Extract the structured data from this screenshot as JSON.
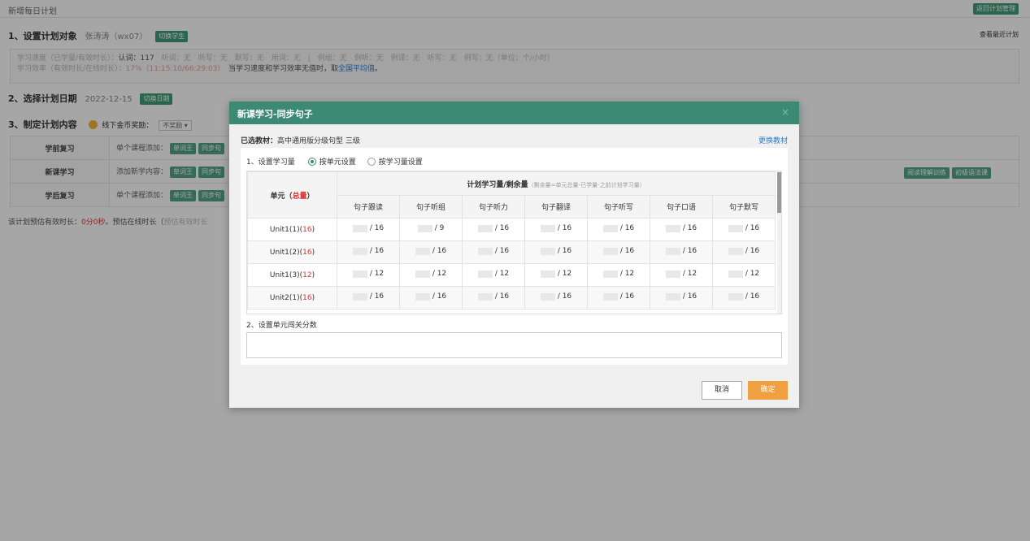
{
  "page": {
    "title": "新增每日计划",
    "back_button": "返回计划管理",
    "section1": {
      "label": "1、设置计划对象",
      "student": "张涛涛（wx07）",
      "switch_student": "切换学生",
      "view_recent": "查看最近计划"
    },
    "stats": {
      "speed_label": "学习速度（已学量/有效时长）：",
      "speed_highlight": "认词：117",
      "speed_rest": "听词：无　听写：无　默写：无　用词：无　|　例组：无　例听：无　例译：无　听写：无　例写：无（单位：个/小时）",
      "eff_label": "学习效率（有效时长/在线时长）：",
      "eff_value": "17%（11:15:10/66:29:03）",
      "eff_note": "当学习速度和学习效率无值时，取",
      "eff_link": "全国平均值",
      "eff_end": "。"
    },
    "section2": {
      "label": "2、选择计划日期",
      "date": "2022-12-15",
      "switch_date": "切换日期"
    },
    "section3": {
      "label": "3、制定计划内容",
      "coin_label": "线下金币奖励：",
      "coin_select": "不奖励 ▾"
    },
    "plan_rows": [
      {
        "head": "学前复习",
        "text": "单个课程添加：",
        "b1": "单词王",
        "b2": "同步句"
      },
      {
        "head": "新课学习",
        "text": "添加新学内容：",
        "b1": "单词王",
        "b2": "同步句",
        "r1": "阅读理解训练",
        "r2": "初级语法课"
      },
      {
        "head": "学后复习",
        "text": "单个课程添加：",
        "b1": "单词王",
        "b2": "同步句"
      }
    ],
    "estimate": {
      "label": "该计划预估有效时长：",
      "value": "0分0秒",
      "label2": "。预估在线时长（",
      "muted": "预估有效时长"
    }
  },
  "modal": {
    "title": "新课学习-同步句子",
    "close": "×",
    "material_label": "已选教材：",
    "material_value": "高中通用版分级句型 三级",
    "change_material": "更换教材",
    "step1": "1、设置学习量",
    "radio_unit": "按单元设置",
    "radio_amount": "按学习量设置",
    "table": {
      "unit_header": "单元（",
      "unit_header_red": "总量",
      "unit_header_end": "）",
      "group_header": "计划学习量/剩余量",
      "group_hint": "（剩余量=单元总量-已学量-之前计划学习量）",
      "columns": [
        "句子跟读",
        "句子听组",
        "句子听力",
        "句子翻译",
        "句子听写",
        "句子口语",
        "句子默写"
      ],
      "rows": [
        {
          "unit": "Unit1(1)(",
          "total": "16",
          "end": ")",
          "values": [
            "/ 16",
            "/ 9",
            "/ 16",
            "/ 16",
            "/ 16",
            "/ 16",
            "/ 16"
          ]
        },
        {
          "unit": "Unit1(2)(",
          "total": "16",
          "end": ")",
          "values": [
            "/ 16",
            "/ 16",
            "/ 16",
            "/ 16",
            "/ 16",
            "/ 16",
            "/ 16"
          ]
        },
        {
          "unit": "Unit1(3)(",
          "total": "12",
          "end": ")",
          "values": [
            "/ 12",
            "/ 12",
            "/ 12",
            "/ 12",
            "/ 12",
            "/ 12",
            "/ 12"
          ]
        },
        {
          "unit": "Unit2(1)(",
          "total": "16",
          "end": ")",
          "values": [
            "/ 16",
            "/ 16",
            "/ 16",
            "/ 16",
            "/ 16",
            "/ 16",
            "/ 16"
          ]
        }
      ]
    },
    "step2": "2、设置单元闯关分数",
    "score_value": "",
    "cancel": "取消",
    "confirm": "确定"
  }
}
